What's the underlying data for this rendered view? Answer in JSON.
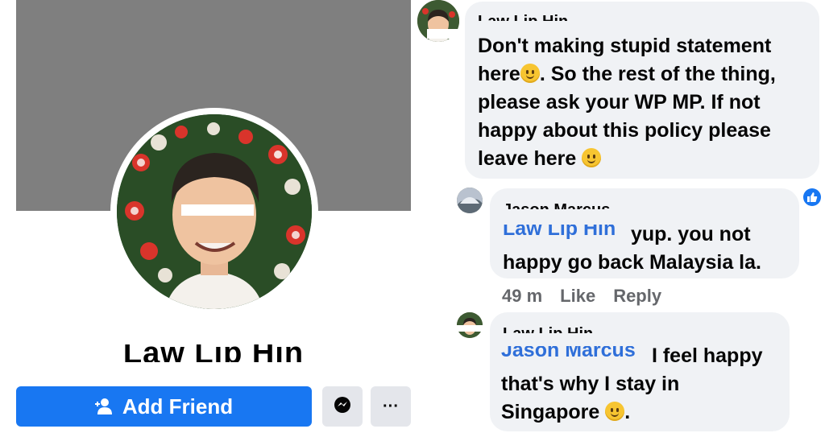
{
  "profile": {
    "name": "Law Lip Hin",
    "add_friend_label": "Add Friend",
    "more_label": "···"
  },
  "comments": [
    {
      "author": "Law Lip Hin",
      "lines": [
        "Don't making stupid statement",
        "here",
        ". So the rest of the thing,",
        "please ask your WP MP. If not",
        "happy about this policy please",
        "leave here"
      ]
    },
    {
      "author": "Jason Marcus",
      "mention": "Law Lip Hin",
      "lines": [
        "yup. you not",
        "happy go back Malaysia la."
      ],
      "time": "49 m",
      "like_label": "Like",
      "reply_label": "Reply"
    },
    {
      "author": "Law Lip Hin",
      "mention": "Jason Marcus",
      "lines": [
        "I feel happy",
        "that's why I stay in",
        "Singapore",
        "."
      ]
    }
  ],
  "colors": {
    "brand_blue": "#1877f2",
    "cover_gray": "#7f7f7f",
    "bubble_gray": "#f0f2f5",
    "mention_blue": "#2f6fd9",
    "meta_gray": "#65676b"
  }
}
